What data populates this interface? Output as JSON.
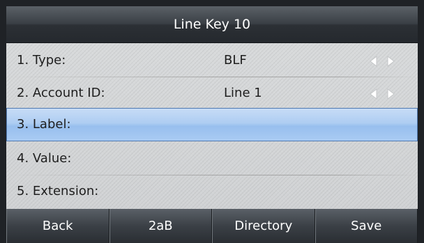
{
  "header": {
    "title": "Line Key 10"
  },
  "rows": [
    {
      "label": "1. Type:",
      "value": "BLF",
      "has_arrows": true
    },
    {
      "label": "2. Account ID:",
      "value": "Line 1",
      "has_arrows": true
    },
    {
      "label": "3. Label:",
      "value": "",
      "selected": true
    },
    {
      "label": "4. Value:",
      "value": ""
    },
    {
      "label": "5. Extension:",
      "value": ""
    }
  ],
  "softkeys": [
    "Back",
    "2aB",
    "Directory",
    "Save"
  ],
  "colors": {
    "selection": "#a9cbf3",
    "title_bar": "#3a3f45",
    "panel": "#d4d6d8"
  }
}
